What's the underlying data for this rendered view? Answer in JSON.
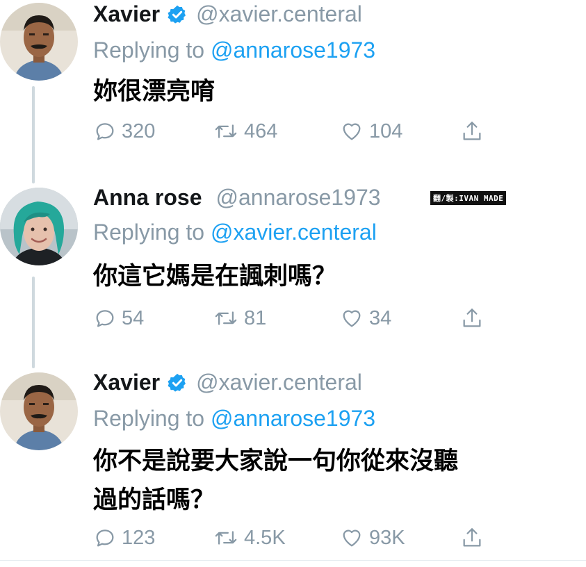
{
  "watermark": "翻/製:IVAN MADE",
  "tweets": [
    {
      "author": "Xavier",
      "handle": "@xavier.centeral",
      "verified": true,
      "replying_prefix": "Replying to ",
      "replying_to": "@annarose1973",
      "text": "妳很漂亮唷",
      "replies": "320",
      "retweets": "464",
      "likes": "104",
      "avatar": "xavier-avatar"
    },
    {
      "author": "Anna rose",
      "handle": "@annarose1973",
      "verified": false,
      "replying_prefix": "Replying to ",
      "replying_to": "@xavier.centeral",
      "text": "你這它媽是在諷刺嗎？",
      "replies": "54",
      "retweets": "81",
      "likes": "34",
      "avatar": "anna-avatar"
    },
    {
      "author": "Xavier",
      "handle": "@xavier.centeral",
      "verified": true,
      "replying_prefix": "Replying to ",
      "replying_to": "@annarose1973",
      "text_line1": "你不是說要大家說一句你從來沒聽",
      "text_line2": "過的話嗎？",
      "replies": "123",
      "retweets": "4.5K",
      "likes": "93K",
      "avatar": "xavier-avatar"
    }
  ],
  "icons": {
    "reply": "speech-bubble-icon",
    "retweet": "retweet-arrows-icon",
    "like": "heart-icon",
    "share": "share-upload-icon",
    "verified": "verified-badge-icon"
  },
  "colors": {
    "name": "#14171a",
    "meta": "#8899a6",
    "mention": "#1da1f2",
    "verified": "#1da1f2",
    "thread_line": "#cfd9de"
  }
}
